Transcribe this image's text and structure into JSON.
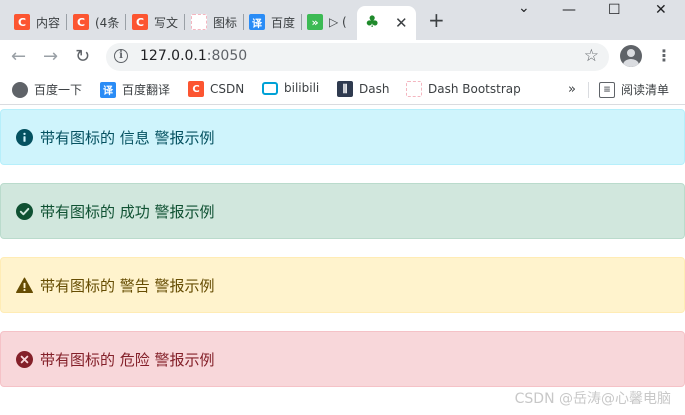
{
  "browser": {
    "tabs": [
      {
        "title": "内容",
        "favicon": "csdn-icon",
        "color": "#fc5531",
        "glyph": "C"
      },
      {
        "title": "(4条",
        "favicon": "csdn-icon",
        "color": "#fc5531",
        "glyph": "C"
      },
      {
        "title": "写文",
        "favicon": "csdn-icon",
        "color": "#fc5531",
        "glyph": "C"
      },
      {
        "title": "图标",
        "favicon": "page-icon",
        "color": "#f4b6c0",
        "glyph": ""
      },
      {
        "title": "百度",
        "favicon": "translate-icon",
        "color": "#2a8cf6",
        "glyph": "译"
      },
      {
        "title": "▷ (",
        "favicon": "forward-icon",
        "color": "#3cba54",
        "glyph": "»"
      },
      {
        "title": "",
        "favicon": "clover-icon",
        "color": "#1f8a2b",
        "glyph": "♣",
        "active": true
      }
    ],
    "new_tab": "+",
    "close_tab": "✕",
    "window_controls": {
      "dropdown": "⌄",
      "minimize": "—",
      "maximize": "☐",
      "close": "✕"
    },
    "nav": {
      "back": "←",
      "forward": "→",
      "reload": "↻"
    },
    "address": {
      "host": "127.0.0.1",
      "port": ":8050"
    },
    "bookmark_star": "☆",
    "menu": "⋮"
  },
  "bookmarks": {
    "items": [
      {
        "label": "百度一下",
        "icon": "globe-icon",
        "color": "#5f6368",
        "glyph": "🌐"
      },
      {
        "label": "百度翻译",
        "icon": "translate-icon",
        "color": "#2a8cf6",
        "glyph": "译"
      },
      {
        "label": "CSDN",
        "icon": "csdn-icon",
        "color": "#fc5531",
        "glyph": "C"
      },
      {
        "label": "bilibili",
        "icon": "bilibili-icon",
        "color": "#00a1d6",
        "glyph": "▭"
      },
      {
        "label": "Dash",
        "icon": "dash-icon",
        "color": "#2f3a4f",
        "glyph": "▥"
      },
      {
        "label": "Dash Bootstrap",
        "icon": "page-icon",
        "color": "#f4b6c0",
        "glyph": ""
      }
    ],
    "more": "»",
    "reading_list": "阅读清单"
  },
  "alerts": [
    {
      "type": "info",
      "icon": "info-circle-icon",
      "text": "带有图标的 信息 警报示例"
    },
    {
      "type": "success",
      "icon": "check-circle-icon",
      "text": "带有图标的 成功 警报示例"
    },
    {
      "type": "warning",
      "icon": "warning-triangle-icon",
      "text": "带有图标的 警告 警报示例"
    },
    {
      "type": "danger",
      "icon": "x-circle-icon",
      "text": "带有图标的 危险 警报示例"
    }
  ],
  "watermark": "CSDN @岳涛@心馨电脑"
}
